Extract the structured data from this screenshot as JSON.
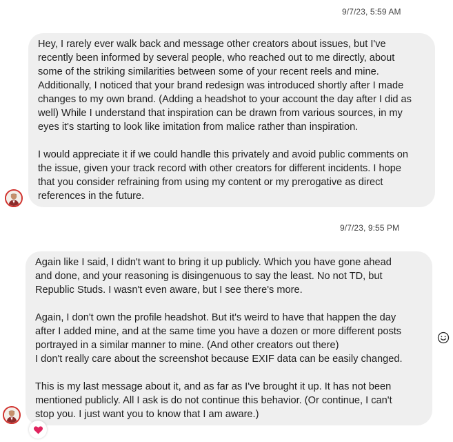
{
  "conversation": {
    "timestamps": [
      "9/7/23, 5:59 AM",
      "9/7/23, 9:55 PM"
    ],
    "messages": [
      {
        "paragraphs": [
          "Hey, I rarely ever walk back and message other creators about issues, but I've\nrecently been informed by several people, who reached out to me directly, about\nsome of the striking similarities between some of your recent reels and mine.\nAdditionally, I noticed that your brand redesign was introduced shortly after I made\nchanges to my own brand. (Adding a headshot to your account the day after I did as\nwell) While I understand that inspiration can be drawn from various sources, in my\neyes it's starting to look like imitation from malice rather than inspiration.",
          "I would appreciate it if we could handle this privately and avoid public comments on\nthe issue, given your track record with other creators for different incidents. I hope\nthat you consider refraining from using my content or my prerogative as direct\nreferences in the future."
        ]
      },
      {
        "paragraphs": [
          "Again like I said, I didn't want to bring it up publicly. Which you have gone ahead\nand done, and your reasoning is disingenuous to say the least. No not TD, but\nRepublic Studs. I wasn't even aware, but I see there's more.",
          "Again, I don't own the profile headshot. But it's weird to have that happen the day\nafter I added mine, and at the same time you have a dozen or more different posts\nportrayed in a similar manner to mine. (And other creators out there)\nI don't really care about the screenshot because EXIF data can be easily changed.",
          "This is my last message about it, and as far as I've brought it up. It has not been\nmentioned publicly. All I ask is do not continue this behavior. (Or continue, I can't\nstop you. I just want you to know that I am aware.)"
        ]
      }
    ]
  },
  "reactions": {
    "emoji_icon": "smiley-face-icon",
    "heart_icon": "heart-icon",
    "heart_color": "#e0245e"
  },
  "colors": {
    "bubble_bg": "#efefef",
    "avatar_ring": "#d0312d"
  }
}
